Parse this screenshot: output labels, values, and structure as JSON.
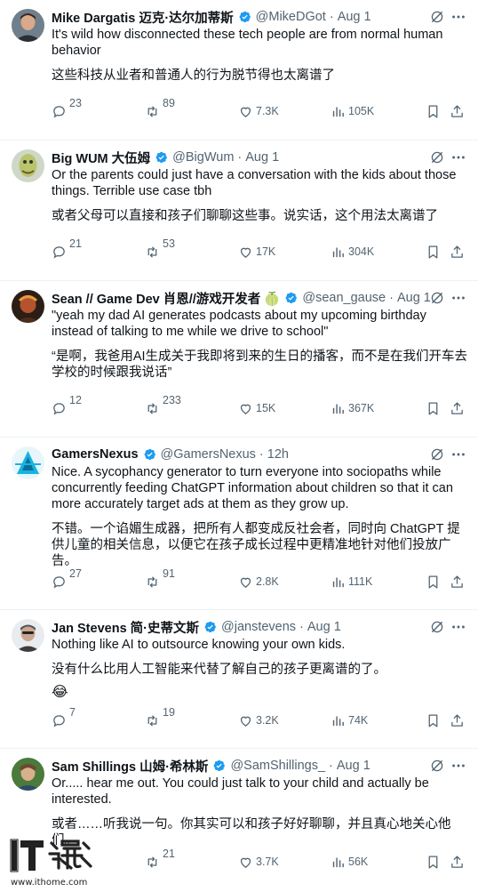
{
  "tweets": [
    {
      "name": "Mike Dargatis 迈克·达尔加蒂斯",
      "handle": "@MikeDGot",
      "time": "Aug 1",
      "text": "It's wild how disconnected these tech people are from normal human behavior",
      "translation": "这些科技从业者和普通人的行为脱节得也太离谱了",
      "emoji": "",
      "replies": "23",
      "reposts": "89",
      "likes": "7.3K",
      "views": "105K"
    },
    {
      "name": "Big WUM 大伍姆",
      "handle": "@BigWum",
      "time": "Aug 1",
      "text": "Or the parents could just have a conversation with the kids about those things. Terrible use case tbh",
      "translation": "或者父母可以直接和孩子们聊聊这些事。说实话，这个用法太离谱了",
      "emoji": "",
      "replies": "21",
      "reposts": "53",
      "likes": "17K",
      "views": "304K"
    },
    {
      "name": "Sean // Game Dev 肖恩//游戏开发者 🍈",
      "handle": "@sean_gause",
      "time": "Aug 1",
      "text": "\"yeah my dad AI generates podcasts about my upcoming birthday instead of talking to me while we drive to school\"",
      "translation": "“是啊，我爸用AI生成关于我即将到来的生日的播客，而不是在我们开车去学校的时候跟我说话”",
      "emoji": "",
      "replies": "12",
      "reposts": "233",
      "likes": "15K",
      "views": "367K"
    },
    {
      "name": "GamersNexus",
      "handle": "@GamersNexus",
      "time": "12h",
      "text": "Nice. A sycophancy generator to turn everyone into sociopaths while concurrently feeding ChatGPT information about children so that it can more accurately target ads at them as they grow up.",
      "translation": "不错。一个谄媚生成器，把所有人都变成反社会者，同时向 ChatGPT 提供儿童的相关信息，以便它在孩子成长过程中更精准地针对他们投放广告。",
      "emoji": "",
      "replies": "27",
      "reposts": "91",
      "likes": "2.8K",
      "views": "111K"
    },
    {
      "name": "Jan Stevens 简·史蒂文斯",
      "handle": "@janstevens",
      "time": "Aug 1",
      "text": "Nothing like AI to outsource knowing your own kids.",
      "translation": "没有什么比用人工智能来代替了解自己的孩子更离谱的了。",
      "emoji": "😂",
      "replies": "7",
      "reposts": "19",
      "likes": "3.2K",
      "views": "74K"
    },
    {
      "name": "Sam Shillings 山姆·希林斯",
      "handle": "@SamShillings_",
      "time": "Aug 1",
      "text": "Or..... hear me out.  You could just talk to your child and actually be interested.",
      "translation": "或者……听我说一句。你其实可以和孩子好好聊聊，并且真心地关心他们。",
      "emoji": "",
      "replies": "",
      "reposts": "21",
      "likes": "3.7K",
      "views": "56K"
    }
  ],
  "watermark": {
    "url": "www.ithome.com"
  },
  "colors": {
    "text": "#0f1419",
    "secondary": "#536471",
    "verified": "#1d9bf0",
    "divider": "#eff3f4"
  }
}
